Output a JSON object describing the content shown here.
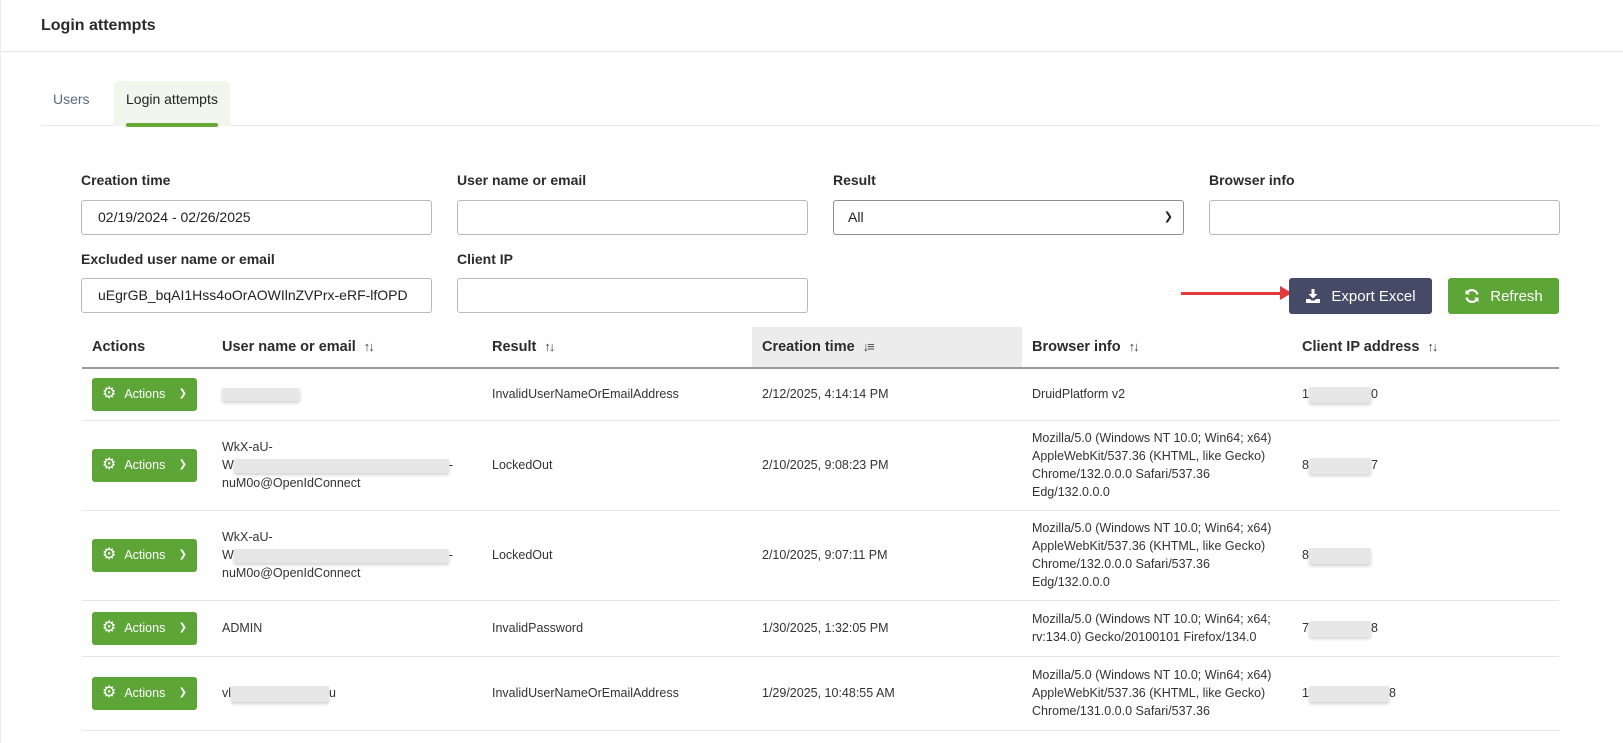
{
  "header": {
    "title": "Login attempts"
  },
  "tabs": [
    {
      "label": "Users",
      "active": false
    },
    {
      "label": "Login attempts",
      "active": true
    }
  ],
  "filters": {
    "creation_time": {
      "label": "Creation time",
      "value": "02/19/2024 - 02/26/2025"
    },
    "user_name": {
      "label": "User name or email",
      "value": ""
    },
    "result": {
      "label": "Result",
      "value": "All"
    },
    "browser_info": {
      "label": "Browser info",
      "value": ""
    },
    "excluded_user": {
      "label": "Excluded user name or email",
      "value": "uEgrGB_bqAI1Hss4oOrAOWIlnZVPrx-eRF-lfOPD"
    },
    "client_ip": {
      "label": "Client IP",
      "value": ""
    }
  },
  "buttons": {
    "export": "Export Excel",
    "refresh": "Refresh"
  },
  "table": {
    "headers": {
      "actions": "Actions",
      "user": "User name or email",
      "result": "Result",
      "creation_time": "Creation time",
      "browser": "Browser info",
      "ip": "Client IP address"
    },
    "action_label": "Actions",
    "rows": [
      {
        "user_line1": "",
        "user_line2_prefix": "",
        "user_line2_suffix": "",
        "user_line3": "",
        "result": "InvalidUserNameOrEmailAddress",
        "time": "2/12/2025, 4:14:14 PM",
        "browser": "DruidPlatform v2",
        "ip_prefix": "1",
        "ip_suffix": "0"
      },
      {
        "user_line1": "WkX-aU-",
        "user_line2_prefix": "W",
        "user_line2_suffix": "-",
        "user_line3": "nuM0o@OpenIdConnect",
        "result": "LockedOut",
        "time": "2/10/2025, 9:08:23 PM",
        "browser": "Mozilla/5.0 (Windows NT 10.0; Win64; x64) AppleWebKit/537.36 (KHTML, like Gecko) Chrome/132.0.0.0 Safari/537.36 Edg/132.0.0.0",
        "ip_prefix": "8",
        "ip_suffix": "7"
      },
      {
        "user_line1": "WkX-aU-",
        "user_line2_prefix": "W",
        "user_line2_suffix": "-",
        "user_line3": "nuM0o@OpenIdConnect",
        "result": "LockedOut",
        "time": "2/10/2025, 9:07:11 PM",
        "browser": "Mozilla/5.0 (Windows NT 10.0; Win64; x64) AppleWebKit/537.36 (KHTML, like Gecko) Chrome/132.0.0.0 Safari/537.36 Edg/132.0.0.0",
        "ip_prefix": "8",
        "ip_suffix": ""
      },
      {
        "user_line1": "ADMIN",
        "user_line2_prefix": "",
        "user_line2_suffix": "",
        "user_line3": "",
        "result": "InvalidPassword",
        "time": "1/30/2025, 1:32:05 PM",
        "browser": "Mozilla/5.0 (Windows NT 10.0; Win64; x64; rv:134.0) Gecko/20100101 Firefox/134.0",
        "ip_prefix": "7",
        "ip_suffix": "8"
      },
      {
        "user_line1": "vl",
        "user_line2_prefix": "",
        "user_line2_suffix": "u",
        "user_line3": "",
        "result": "InvalidUserNameOrEmailAddress",
        "time": "1/29/2025, 10:48:55 AM",
        "browser": "Mozilla/5.0 (Windows NT 10.0; Win64; x64) AppleWebKit/537.36 (KHTML, like Gecko) Chrome/131.0.0.0 Safari/537.36",
        "ip_prefix": "1",
        "ip_suffix": "8"
      }
    ]
  },
  "colors": {
    "accent_green": "#5ea538",
    "export_button": "#454a66",
    "arrow_red": "#e5393b"
  }
}
